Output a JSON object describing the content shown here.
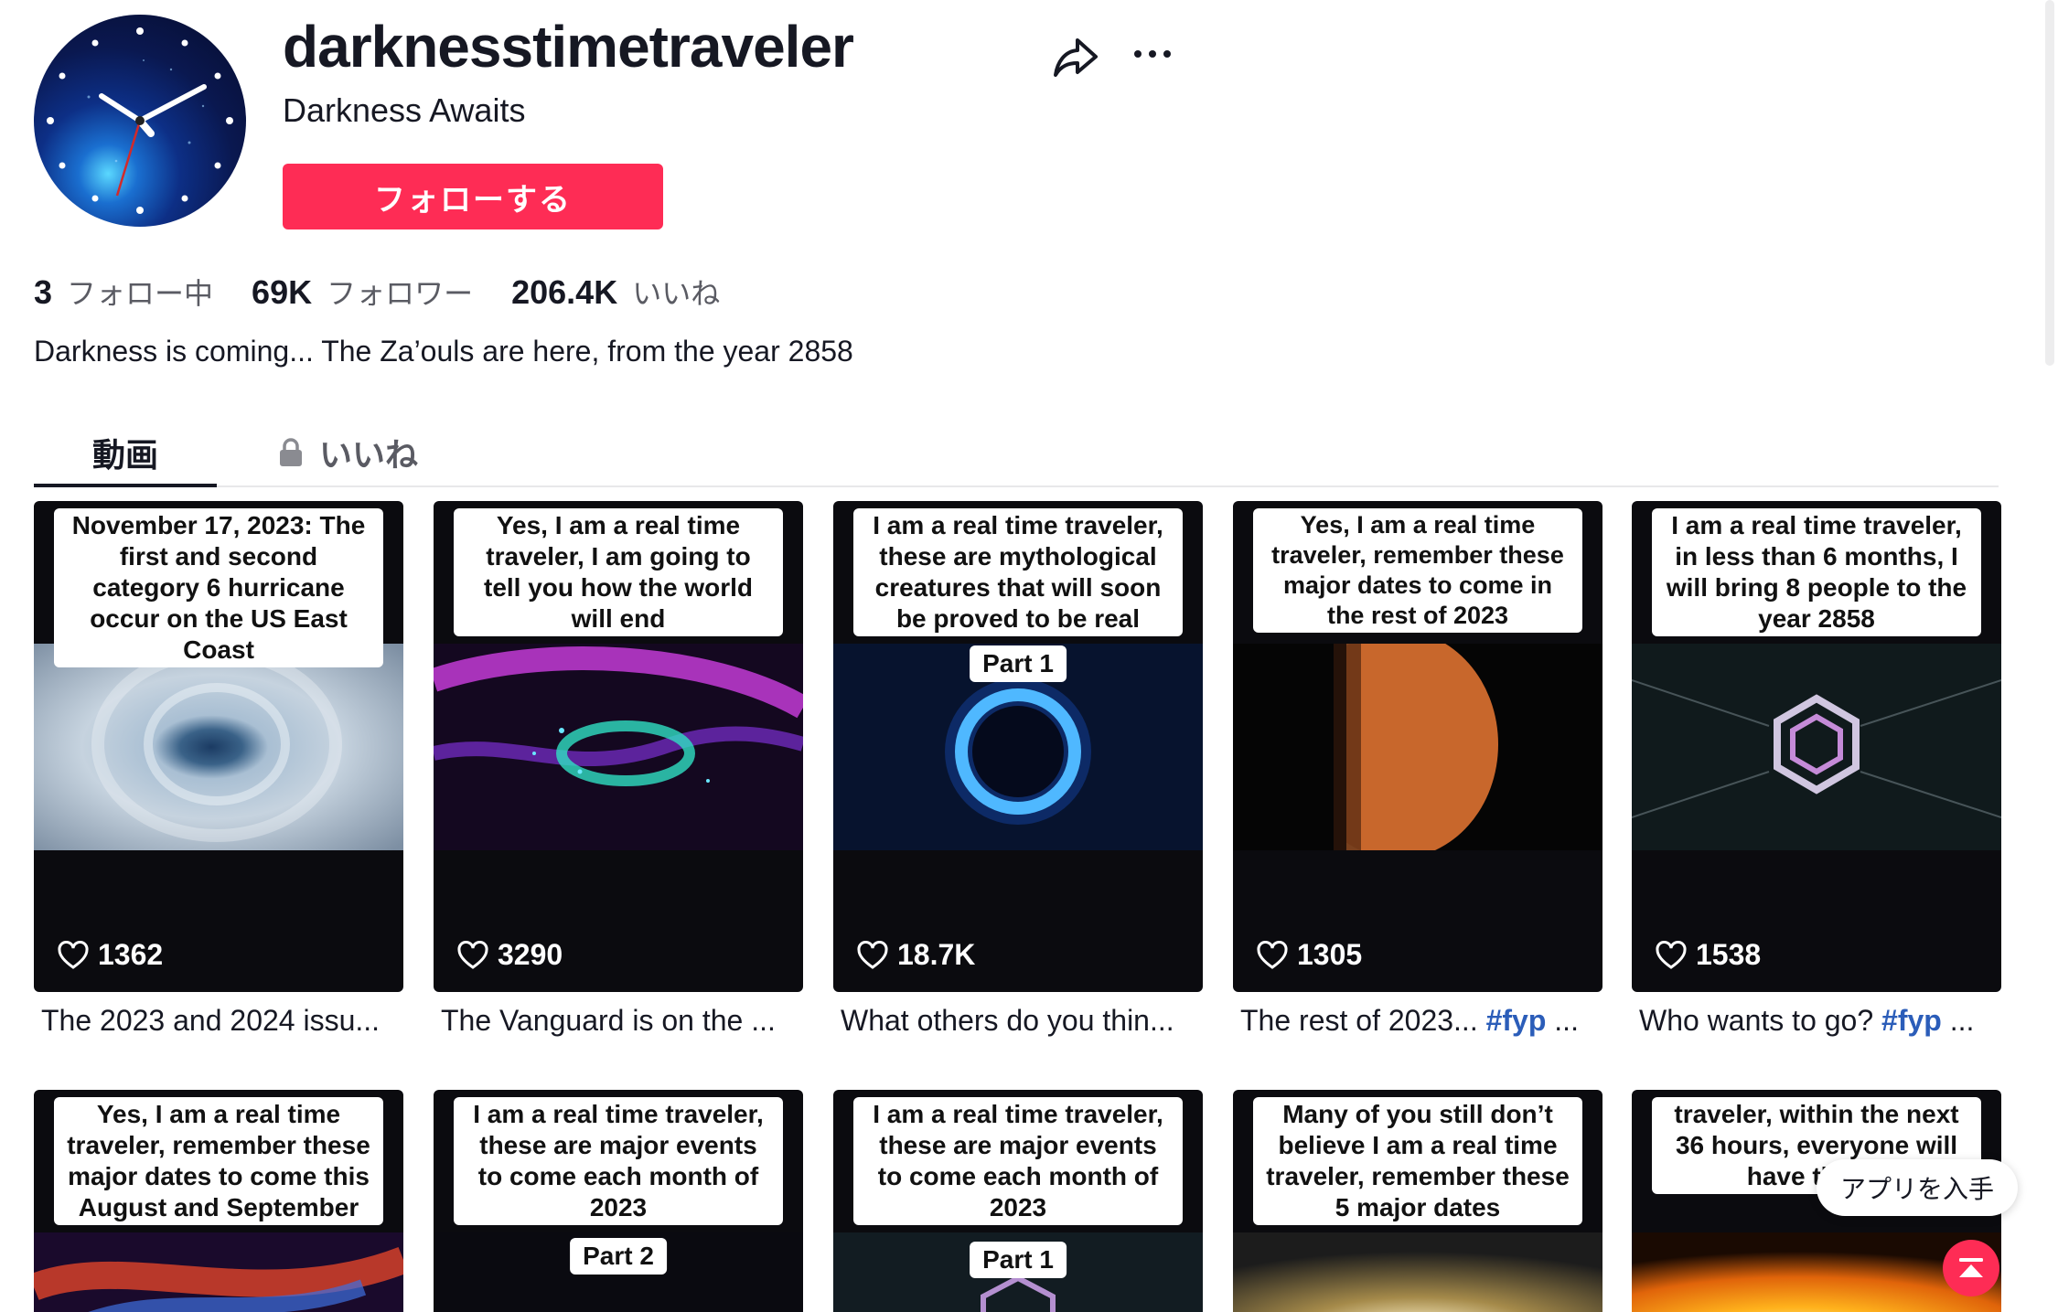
{
  "profile": {
    "username": "darknesstimetraveler",
    "nickname": "Darkness Awaits",
    "follow_label": "フォローする",
    "bio": "Darkness is coming... The Za’ouls are here, from the year 2858"
  },
  "stats": [
    {
      "value": "3",
      "label": "フォロー中"
    },
    {
      "value": "69K",
      "label": "フォロワー"
    },
    {
      "value": "206.4K",
      "label": "いいね"
    }
  ],
  "tabs": {
    "videos": "動画",
    "liked": "いいね"
  },
  "videos": [
    {
      "caption": "November 17, 2023: The first and second category 6 hurricane occur on the US East Coast",
      "likes": "1362",
      "desc": "The 2023 and 2024 issu...",
      "tag": ""
    },
    {
      "caption": "Yes, I am a real time traveler, I am going to tell you how the world will end",
      "likes": "3290",
      "desc": "The Vanguard is on the ...",
      "tag": ""
    },
    {
      "caption": "I am a real time traveler, these are mythological creatures that will soon be proved to be real",
      "part": "Part 1",
      "likes": "18.7K",
      "desc": "What others do you thin...",
      "tag": ""
    },
    {
      "caption": "Yes, I am a real time traveler, remember these major dates to come in the rest of 2023",
      "likes": "1305",
      "desc": "The rest of 2023... ",
      "tag": "#fyp",
      "tail": " ..."
    },
    {
      "caption": "I am a real time traveler, in less than 6 months, I will bring 8 people to the year 2858",
      "likes": "1538",
      "desc": "Who wants to go? ",
      "tag": "#fyp",
      "tail": " ..."
    },
    {
      "caption": "Yes, I am a real time traveler, remember these major dates to come this August and September"
    },
    {
      "caption": "I am a real time traveler, these are major events to come each month of 2023",
      "part": "Part 2"
    },
    {
      "caption": "I am a real time traveler, these are major events to come each month of 2023",
      "part": "Part 1"
    },
    {
      "caption": "Many of you still don’t believe I am a real time traveler, remember these 5 major dates"
    },
    {
      "caption": "traveler, within the next 36 hours, everyone will have the sa"
    }
  ],
  "floating": {
    "get_app": "アプリを入手"
  },
  "colors": {
    "accent": "#fe2c55",
    "hashtag": "#2b5db9",
    "text": "#161823",
    "muted": "#5a5b63"
  }
}
